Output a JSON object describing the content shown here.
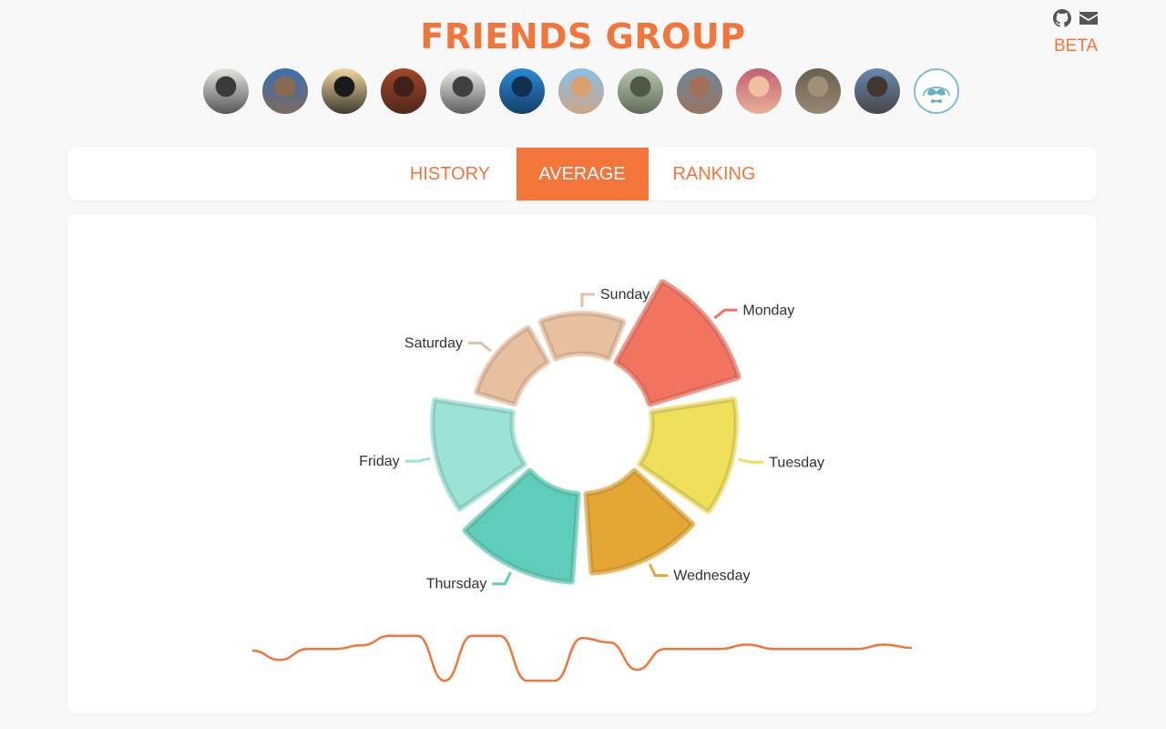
{
  "header": {
    "title": "FRIENDS GROUP",
    "badge": "BETA",
    "icons": [
      "github-icon",
      "mail-icon"
    ]
  },
  "avatars": [
    {
      "name": "friend-1",
      "colors": [
        "#e8e5e0",
        "#3a3a3a"
      ]
    },
    {
      "name": "friend-2",
      "colors": [
        "#3a6fb0",
        "#8a6a50"
      ]
    },
    {
      "name": "friend-3",
      "colors": [
        "#f2d8a0",
        "#1a1a1a"
      ]
    },
    {
      "name": "friend-4",
      "colors": [
        "#a04828",
        "#402018"
      ]
    },
    {
      "name": "friend-5",
      "colors": [
        "#f0f0f0",
        "#404040"
      ]
    },
    {
      "name": "friend-6",
      "colors": [
        "#2a8ad8",
        "#103050"
      ]
    },
    {
      "name": "friend-7",
      "colors": [
        "#8ac0e8",
        "#d8a070"
      ]
    },
    {
      "name": "friend-8",
      "colors": [
        "#b8c8b0",
        "#505848"
      ]
    },
    {
      "name": "friend-9",
      "colors": [
        "#708898",
        "#a07058"
      ]
    },
    {
      "name": "friend-10",
      "colors": [
        "#c06070",
        "#f0c0a0"
      ]
    },
    {
      "name": "friend-11",
      "colors": [
        "#6a6050",
        "#a09078"
      ]
    },
    {
      "name": "friend-12",
      "colors": [
        "#6a8ab0",
        "#403830"
      ]
    },
    {
      "name": "add-friend",
      "icon": "mustache-icon"
    }
  ],
  "tabs": [
    {
      "label": "HISTORY",
      "active": false
    },
    {
      "label": "AVERAGE",
      "active": true
    },
    {
      "label": "RANKING",
      "active": false
    }
  ],
  "accent": "#f4753a",
  "chart_data": {
    "type": "radial-bar",
    "categories": [
      "Sunday",
      "Monday",
      "Tuesday",
      "Wednesday",
      "Thursday",
      "Friday",
      "Saturday"
    ],
    "values": [
      0.42,
      1.0,
      0.9,
      0.85,
      0.95,
      0.85,
      0.42
    ],
    "colors": [
      "#e8c0a0",
      "#f27461",
      "#efdf5a",
      "#e4a734",
      "#5ecdb9",
      "#9ae3d6",
      "#e8c0a0"
    ],
    "trend_values": [
      35,
      18,
      38,
      38,
      45,
      62,
      62,
      -20,
      62,
      62,
      -20,
      -20,
      58,
      50,
      0,
      38,
      38,
      38,
      46,
      38,
      38,
      38,
      38,
      46,
      40
    ]
  }
}
